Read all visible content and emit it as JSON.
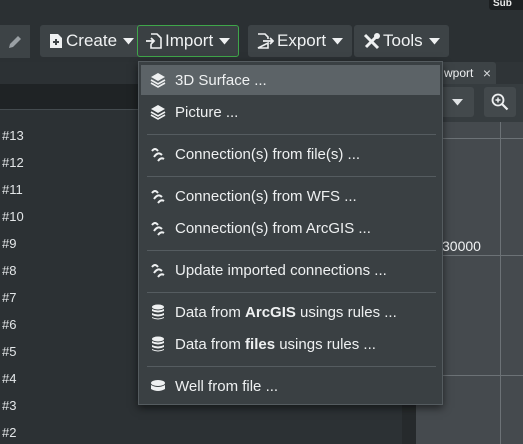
{
  "corner_label": "Sub",
  "toolbar": {
    "create": "Create",
    "import": "Import",
    "export": "Export",
    "tools": "Tools"
  },
  "left_panel": {
    "rows": [
      "#13",
      "#12",
      "#11",
      "#10",
      "#9",
      "#8",
      "#7",
      "#6",
      "#5",
      "#4",
      "#3",
      "#2"
    ]
  },
  "viewport": {
    "tab_label": "wport",
    "tab_close": "×",
    "coordinate_label": "30000"
  },
  "import_menu": {
    "items": [
      {
        "label": "3D Surface ...",
        "icon": "layers-icon"
      },
      {
        "label": "Picture ...",
        "icon": "layers-icon"
      },
      {
        "label": "Connection(s) from file(s) ...",
        "icon": "connection-icon"
      },
      {
        "label": "Connection(s) from WFS ...",
        "icon": "connection-icon"
      },
      {
        "label": "Connection(s) from ArcGIS ...",
        "icon": "connection-icon"
      },
      {
        "label": "Update imported connections ...",
        "icon": "connection-icon"
      },
      {
        "label_pre": "Data from ",
        "label_bold": "ArcGIS",
        "label_post": " usings rules ...",
        "icon": "database-icon"
      },
      {
        "label_pre": "Data from ",
        "label_bold": "files",
        "label_post": " usings rules ...",
        "icon": "database-icon"
      },
      {
        "label": "Well from file ...",
        "icon": "well-icon"
      }
    ]
  },
  "colors": {
    "active_border": "#3fa64a",
    "menu_bg": "#3a4043",
    "menu_hover": "#5c6367"
  }
}
